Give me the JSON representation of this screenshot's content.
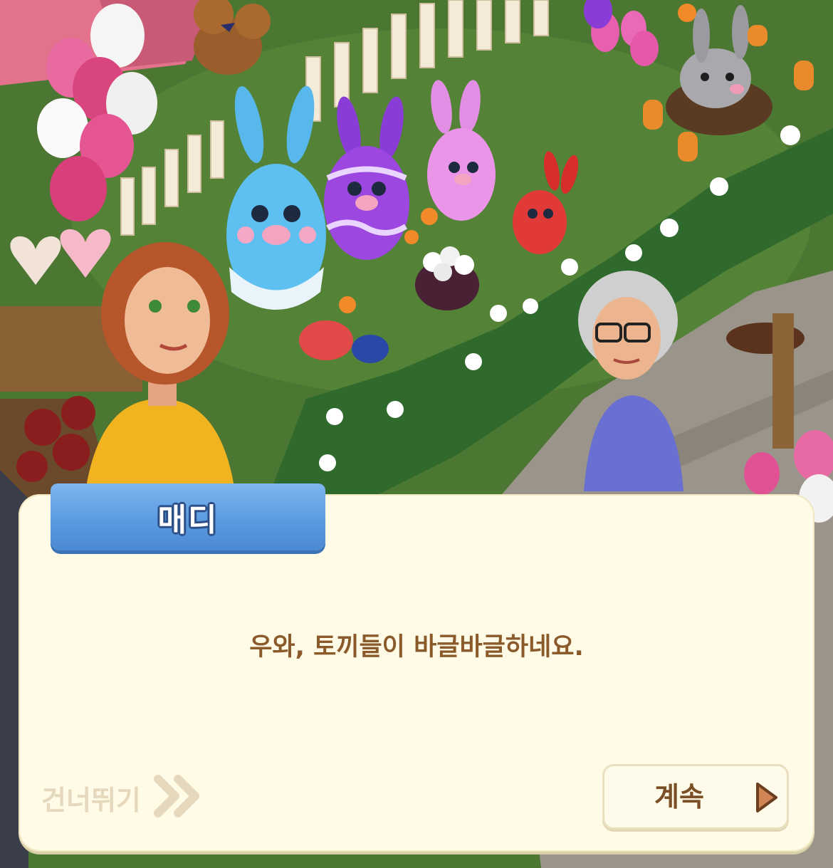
{
  "dialog": {
    "speaker_name": "매디",
    "message": "우와, 토끼들이 바글바글하네요.",
    "skip_label": "건너뛰기",
    "continue_label": "계속"
  },
  "icons": {
    "skip": "double-chevron-right-icon",
    "continue": "play-triangle-icon"
  },
  "colors": {
    "dialog_background": "#fffbe6",
    "name_tag": "#5a9be0",
    "message_text": "#8a5a2b",
    "skip_text": "#e5d8bd",
    "continue_text": "#7a4f25"
  }
}
